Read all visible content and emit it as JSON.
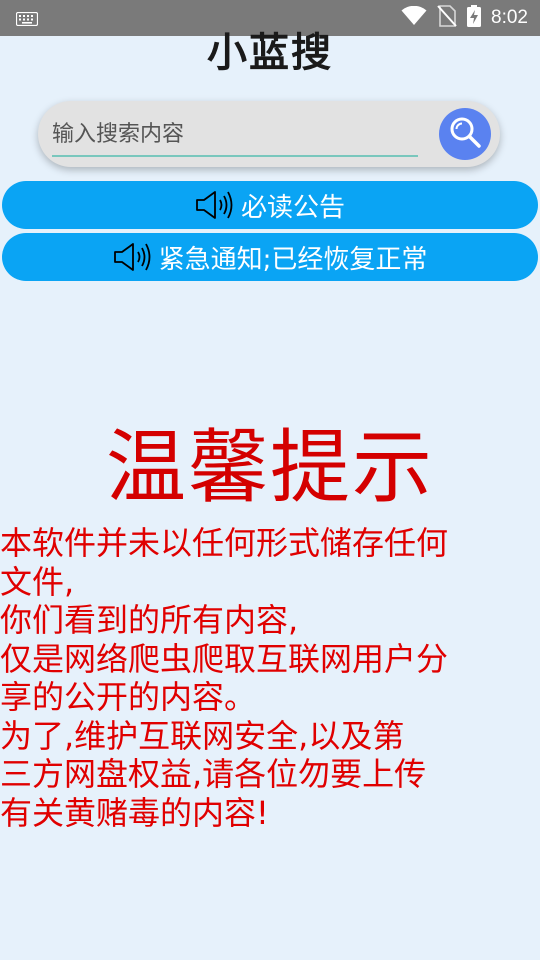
{
  "status_bar": {
    "time": "8:02",
    "icons": [
      "keyboard-icon",
      "wifi-icon",
      "no-sim-icon",
      "battery-charging-icon"
    ],
    "background": "#7a7a7a"
  },
  "app": {
    "title": "小蓝搜"
  },
  "search": {
    "placeholder": "输入搜索内容",
    "value": "",
    "button_icon": "magnifier-icon",
    "button_color": "#5a82f0"
  },
  "notices": [
    {
      "icon": "speaker-icon",
      "label": "必读公告"
    },
    {
      "icon": "speaker-icon",
      "label": "紧急通知;已经恢复正常"
    }
  ],
  "notice_color": "#0aa4f4",
  "tip": {
    "title": "温馨提示",
    "color": "#e00000",
    "lines": [
      "本软件并未以任何形式储存任何",
      "文件,",
      "你们看到的所有内容,",
      "仅是网络爬虫爬取互联网用户分",
      "享的公开的内容。",
      "为了,维护互联网安全,以及第",
      "三方网盘权益,请各位勿要上传",
      "有关黄赌毒的内容!"
    ]
  }
}
